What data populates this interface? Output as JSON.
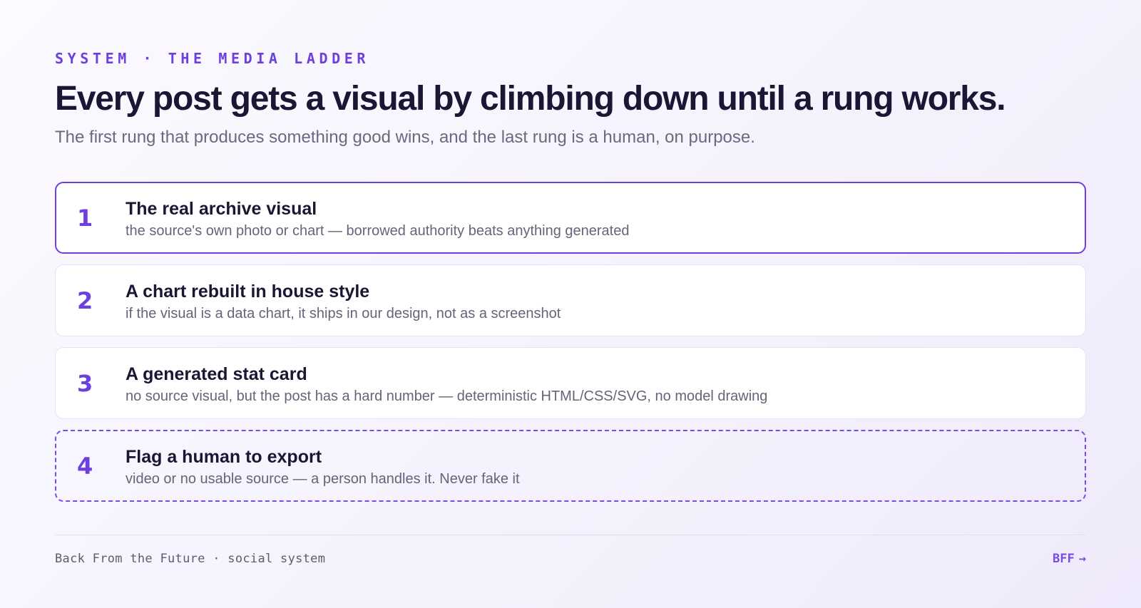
{
  "header": {
    "eyebrow": "SYSTEM · THE MEDIA LADDER",
    "headline": "Every post gets a visual by climbing down until a rung works.",
    "subhead": "The first rung that produces something good wins, and the last rung is a human, on purpose."
  },
  "ladder": {
    "rungs": [
      {
        "number": "1",
        "title": "The real archive visual",
        "description": "the source's own photo or chart — borrowed authority beats anything generated"
      },
      {
        "number": "2",
        "title": "A chart rebuilt in house style",
        "description": "if the visual is a data chart, it ships in our design, not as a screenshot"
      },
      {
        "number": "3",
        "title": "A generated stat card",
        "description": "no source visual, but the post has a hard number — deterministic HTML/CSS/SVG, no model drawing"
      },
      {
        "number": "4",
        "title": "Flag a human to export",
        "description": "video or no usable source — a person handles it. Never fake it"
      }
    ]
  },
  "footer": {
    "left": "Back From the Future · social system",
    "right_label": "BFF",
    "right_arrow": "→"
  },
  "colors": {
    "accent": "#6d3fe0",
    "heading": "#1a1633",
    "muted": "#6b6880"
  }
}
